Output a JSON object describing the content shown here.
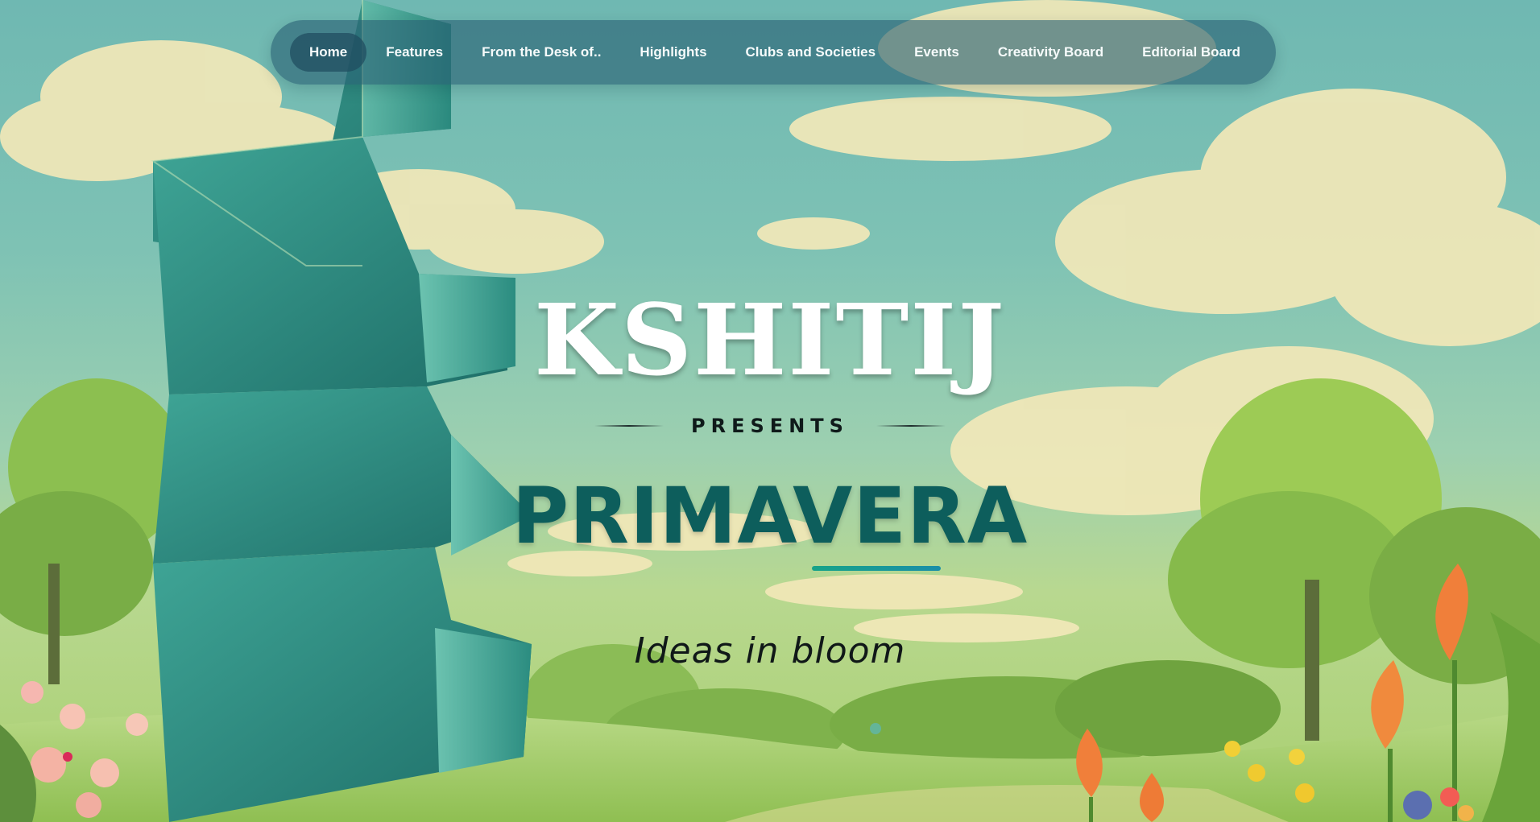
{
  "nav": {
    "items": [
      {
        "label": "Home",
        "active": true
      },
      {
        "label": "Features"
      },
      {
        "label": "From the Desk of.."
      },
      {
        "label": "Highlights"
      },
      {
        "label": "Clubs and Societies"
      },
      {
        "label": "Events"
      },
      {
        "label": "Creativity Board"
      },
      {
        "label": "Editorial Board"
      }
    ]
  },
  "hero": {
    "title": "KSHITIJ",
    "presents": "PRESENTS",
    "subtitle": "PRIMAVERA",
    "tagline": "Ideas in bloom"
  },
  "colors": {
    "sky": "#7ec2b4",
    "nav_bg": "#285f73",
    "subtitle": "#0d5e5c",
    "accent_start": "#17a388",
    "accent_end": "#1a8ea8"
  },
  "icons": [
    "cloud-icon",
    "tree-icon",
    "tulip-icon",
    "flower-icon",
    "sculpture-icon"
  ]
}
